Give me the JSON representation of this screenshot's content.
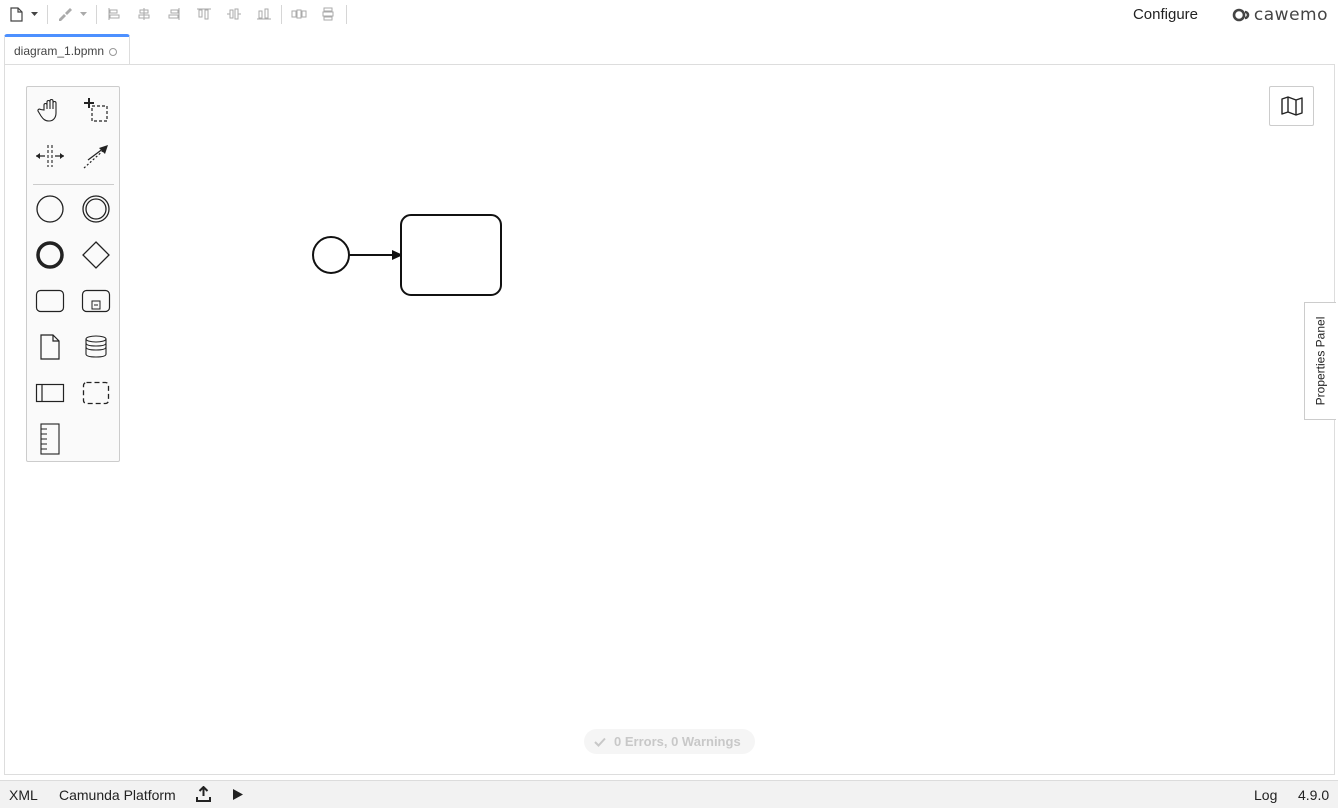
{
  "toolbar": {
    "configure_label": "Configure",
    "brand_text": "cawemo",
    "icons": [
      "new-file-icon",
      "dropdown-caret-icon",
      "color-brush-icon",
      "dropdown-caret-icon",
      "align-left-icon",
      "align-center-icon",
      "align-right-icon",
      "align-top-icon",
      "align-middle-icon",
      "align-bottom-icon",
      "distribute-horizontal-icon",
      "distribute-vertical-icon"
    ]
  },
  "tabs": [
    {
      "label": "diagram_1.bpmn",
      "active": true,
      "accent": "#4d90ff"
    }
  ],
  "palette": {
    "tools": [
      "hand-tool",
      "lasso-tool",
      "space-tool",
      "global-connect-tool"
    ],
    "shapes": [
      "start-event",
      "intermediate-event",
      "end-event",
      "gateway",
      "task",
      "subprocess",
      "data-object",
      "data-store",
      "participant-pool",
      "group",
      "text-annotation"
    ]
  },
  "canvas": {
    "lint_status": "0 Errors, 0 Warnings",
    "properties_panel_label": "Properties Panel"
  },
  "statusbar": {
    "xml_label": "XML",
    "engine_label": "Camunda Platform",
    "log_label": "Log",
    "version": "4.9.0"
  }
}
